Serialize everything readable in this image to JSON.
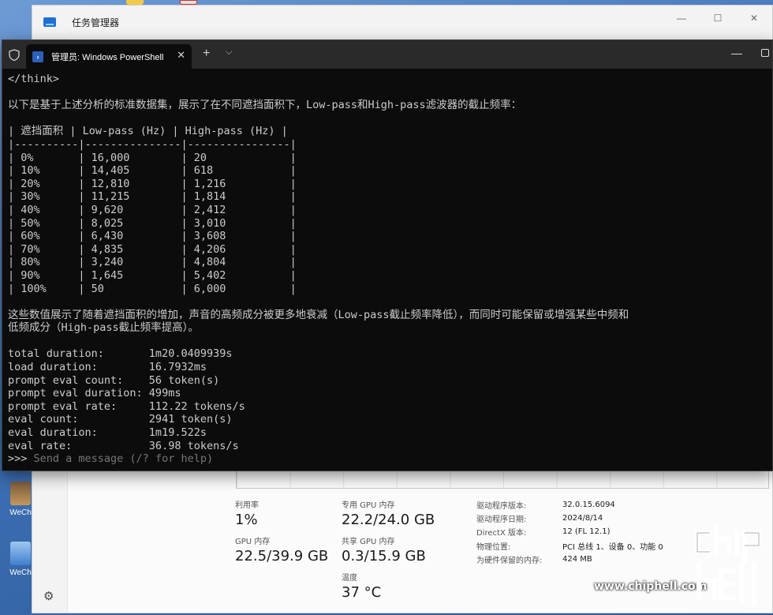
{
  "task_manager": {
    "title": "任务管理器",
    "stats": [
      {
        "label": "利用率",
        "value": "1%"
      },
      {
        "label": "专用 GPU 内存",
        "value": "22.2/24.0 GB"
      },
      {
        "label": "GPU 内存",
        "value": "22.5/39.9 GB"
      },
      {
        "label": "共享 GPU 内存",
        "value": "0.3/15.9 GB"
      },
      {
        "label": "温度",
        "value": "37 °C"
      }
    ],
    "properties": [
      {
        "key": "驱动程序版本:",
        "value": "32.0.15.6094"
      },
      {
        "key": "驱动程序日期:",
        "value": "2024/8/14"
      },
      {
        "key": "DirectX 版本:",
        "value": "12 (FL 12.1)"
      },
      {
        "key": "物理位置:",
        "value": "PCI 总线 1、设备 0、功能 0"
      },
      {
        "key": "为硬件保留的内存:",
        "value": "424 MB"
      }
    ]
  },
  "desktop": {
    "icons": [
      {
        "label": "WeCh"
      },
      {
        "label": "WeCh"
      }
    ]
  },
  "powershell": {
    "tab_label": "管理员: Windows PowerShell",
    "lines": [
      "</think>",
      "",
      "以下是基于上述分析的标准数据集，展示了在不同遮挡面积下，Low-pass和High-pass滤波器的截止频率：",
      "",
      "| 遮挡面积 | Low-pass (Hz) | High-pass (Hz) |",
      "|----------|---------------|----------------|",
      "| 0%       | 16,000        | 20             |",
      "| 10%      | 14,405        | 618            |",
      "| 20%      | 12,810        | 1,216          |",
      "| 30%      | 11,215        | 1,814          |",
      "| 40%      | 9,620         | 2,412          |",
      "| 50%      | 8,025         | 3,010          |",
      "| 60%      | 6,430         | 3,608          |",
      "| 70%      | 4,835         | 4,206          |",
      "| 80%      | 3,240         | 4,804          |",
      "| 90%      | 1,645         | 5,402          |",
      "| 100%     | 50            | 6,000          |",
      "",
      "这些数值展示了随着遮挡面积的增加，声音的高频成分被更多地衰减（Low-pass截止频率降低），而同时可能保留或增强某些中频和",
      "低频成分（High-pass截止频率提高）。",
      "",
      "total duration:       1m20.0409939s",
      "load duration:        16.7932ms",
      "prompt eval count:    56 token(s)",
      "prompt eval duration: 499ms",
      "prompt eval rate:     112.22 tokens/s",
      "eval count:           2941 token(s)",
      "eval duration:        1m19.522s",
      "eval rate:            36.98 tokens/s"
    ],
    "prompt": ">>> ",
    "prompt_hint": "Send a message (/? for help)"
  },
  "watermark": {
    "site": "www.chiphell.com",
    "logo": "chip hell"
  }
}
